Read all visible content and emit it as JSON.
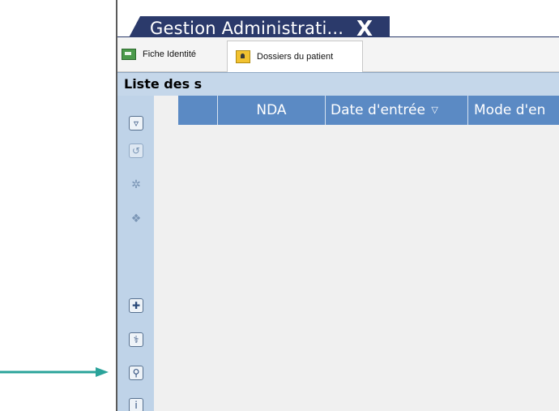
{
  "window": {
    "tab_title": "Gestion Administrati...",
    "close_glyph": "X"
  },
  "subtabs": [
    {
      "label": "Fiche Identité",
      "icon": "id-card-icon"
    },
    {
      "label": "Dossiers du patient",
      "icon": "patient-folder-icon"
    }
  ],
  "list": {
    "title": "Liste des s"
  },
  "grid": {
    "columns": [
      "",
      "",
      "NDA",
      "Date d'entrée",
      "Mode d'en"
    ],
    "sort_indicator": "▽"
  },
  "toolbar": {
    "buttons": [
      {
        "name": "filter-button",
        "glyph": "▿"
      },
      {
        "name": "refresh-button",
        "glyph": "↺"
      },
      {
        "name": "collapse-all-button",
        "glyph": "✲"
      },
      {
        "name": "expand-all-button",
        "glyph": "❖"
      },
      {
        "name": "add-button",
        "glyph": "✚"
      },
      {
        "name": "stethoscope-button",
        "glyph": "⚕"
      },
      {
        "name": "patient-button",
        "glyph": "⚲"
      },
      {
        "name": "info-button",
        "glyph": "i"
      }
    ]
  },
  "colors": {
    "tab_bg": "#2b3a6b",
    "header_blue": "#5b8ac4",
    "toolbar_bg": "#bfd3e8",
    "arrow": "#2aa39a"
  }
}
